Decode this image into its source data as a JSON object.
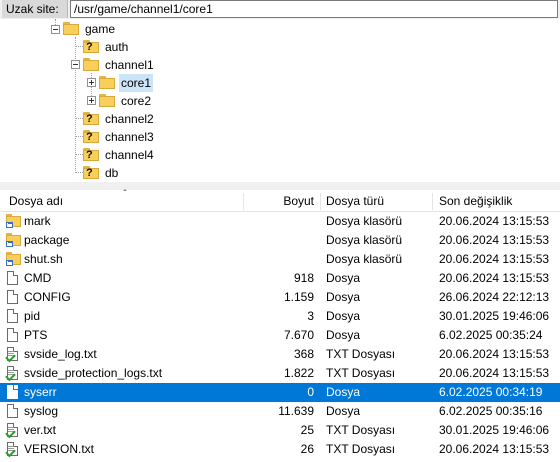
{
  "remote_site": {
    "label": "Uzak site:",
    "path": "/usr/game/channel1/core1"
  },
  "tree": {
    "items": [
      {
        "label": "game",
        "icon": "folder-icon",
        "expander": "minus"
      },
      {
        "label": "auth",
        "icon": "unknown-folder-icon"
      },
      {
        "label": "channel1",
        "icon": "folder-icon",
        "expander": "minus"
      },
      {
        "label": "core1",
        "icon": "folder-icon",
        "expander": "plus",
        "selected": true
      },
      {
        "label": "core2",
        "icon": "folder-icon",
        "expander": "plus"
      },
      {
        "label": "channel2",
        "icon": "unknown-folder-icon"
      },
      {
        "label": "channel3",
        "icon": "unknown-folder-icon"
      },
      {
        "label": "channel4",
        "icon": "unknown-folder-icon"
      },
      {
        "label": "db",
        "icon": "unknown-folder-icon"
      }
    ]
  },
  "list": {
    "columns": {
      "name": "Dosya adı",
      "size": "Boyut",
      "type": "Dosya türü",
      "modified": "Son değişiklik"
    },
    "rows": [
      {
        "name": "mark",
        "size": "",
        "type": "Dosya klasörü",
        "modified": "20.06.2024 13:15:53",
        "icon": "folder-link-icon"
      },
      {
        "name": "package",
        "size": "",
        "type": "Dosya klasörü",
        "modified": "20.06.2024 13:15:53",
        "icon": "folder-link-icon"
      },
      {
        "name": "shut.sh",
        "size": "",
        "type": "Dosya klasörü",
        "modified": "20.06.2024 13:15:53",
        "icon": "folder-link-icon"
      },
      {
        "name": "CMD",
        "size": "918",
        "type": "Dosya",
        "modified": "20.06.2024 13:15:53",
        "icon": "file-icon"
      },
      {
        "name": "CONFIG",
        "size": "1.159",
        "type": "Dosya",
        "modified": "26.06.2024 22:12:13",
        "icon": "file-icon"
      },
      {
        "name": "pid",
        "size": "3",
        "type": "Dosya",
        "modified": "30.01.2025 19:46:06",
        "icon": "file-icon"
      },
      {
        "name": "PTS",
        "size": "7.670",
        "type": "Dosya",
        "modified": "6.02.2025 00:35:24",
        "icon": "file-icon"
      },
      {
        "name": "svside_log.txt",
        "size": "368",
        "type": "TXT Dosyası",
        "modified": "20.06.2024 13:15:53",
        "icon": "text-file-icon"
      },
      {
        "name": "svside_protection_logs.txt",
        "size": "1.822",
        "type": "TXT Dosyası",
        "modified": "20.06.2024 13:15:53",
        "icon": "text-file-icon"
      },
      {
        "name": "syserr",
        "size": "0",
        "type": "Dosya",
        "modified": "6.02.2025 00:34:19",
        "icon": "file-icon",
        "selected": true
      },
      {
        "name": "syslog",
        "size": "11.639",
        "type": "Dosya",
        "modified": "6.02.2025 00:35:16",
        "icon": "file-icon"
      },
      {
        "name": "ver.txt",
        "size": "25",
        "type": "TXT Dosyası",
        "modified": "30.01.2025 19:46:06",
        "icon": "text-file-icon"
      },
      {
        "name": "VERSION.txt",
        "size": "26",
        "type": "TXT Dosyası",
        "modified": "20.06.2024 13:15:53",
        "icon": "text-file-icon"
      }
    ]
  },
  "colors": {
    "selection": "#0078d7",
    "tree_selection": "#cce4f7",
    "folder": "#f7cf5a"
  }
}
